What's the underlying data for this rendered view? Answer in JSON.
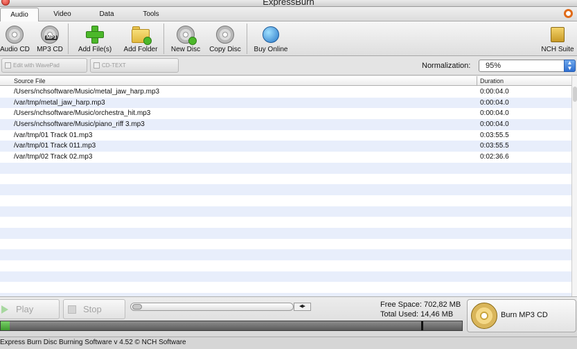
{
  "window": {
    "title": "ExpressBurn"
  },
  "tabs": [
    {
      "label": "Audio",
      "active": true
    },
    {
      "label": "Video",
      "active": false
    },
    {
      "label": "Data",
      "active": false
    },
    {
      "label": "Tools",
      "active": false
    }
  ],
  "toolbar": {
    "audio_cd": "Audio CD",
    "mp3_cd": "MP3 CD",
    "mp3_badge": "MP3",
    "add_files": "Add File(s)",
    "add_folder": "Add Folder",
    "new_disc": "New Disc",
    "copy_disc": "Copy Disc",
    "buy_online": "Buy Online",
    "nch_suite": "NCH Suite"
  },
  "subbar": {
    "edit_wavepad": "Edit with WavePad",
    "cd_text": "CD-TEXT",
    "normalization_label": "Normalization:",
    "normalization_value": "95%"
  },
  "table": {
    "headers": {
      "source": "Source File",
      "duration": "Duration"
    },
    "rows": [
      {
        "file": "/Users/nchsoftware/Music/metal_jaw_harp.mp3",
        "duration": "0:00:04.0"
      },
      {
        "file": "/var/tmp/metal_jaw_harp.mp3",
        "duration": "0:00:04.0"
      },
      {
        "file": "/Users/nchsoftware/Music/orchestra_hit.mp3",
        "duration": "0:00:04.0"
      },
      {
        "file": "/Users/nchsoftware/Music/piano_riff 3.mp3",
        "duration": "0:00:04.0"
      },
      {
        "file": "/var/tmp/01 Track 01.mp3",
        "duration": "0:03:55.5"
      },
      {
        "file": "/var/tmp/01 Track 011.mp3",
        "duration": "0:03:55.5"
      },
      {
        "file": "/var/tmp/02 Track 02.mp3",
        "duration": "0:02:36.6"
      }
    ]
  },
  "playback": {
    "play": "Play",
    "stop": "Stop",
    "position": 0
  },
  "disc": {
    "free_space_label": "Free Space:",
    "free_space_value": "702,82 MB",
    "total_used_label": "Total Used:",
    "total_used_value": "14,46 MB",
    "burn_label": "Burn MP3 CD",
    "used_fraction": 0.02
  },
  "status": {
    "text": "Express Burn Disc Burning Software v 4.52 © NCH Software"
  }
}
